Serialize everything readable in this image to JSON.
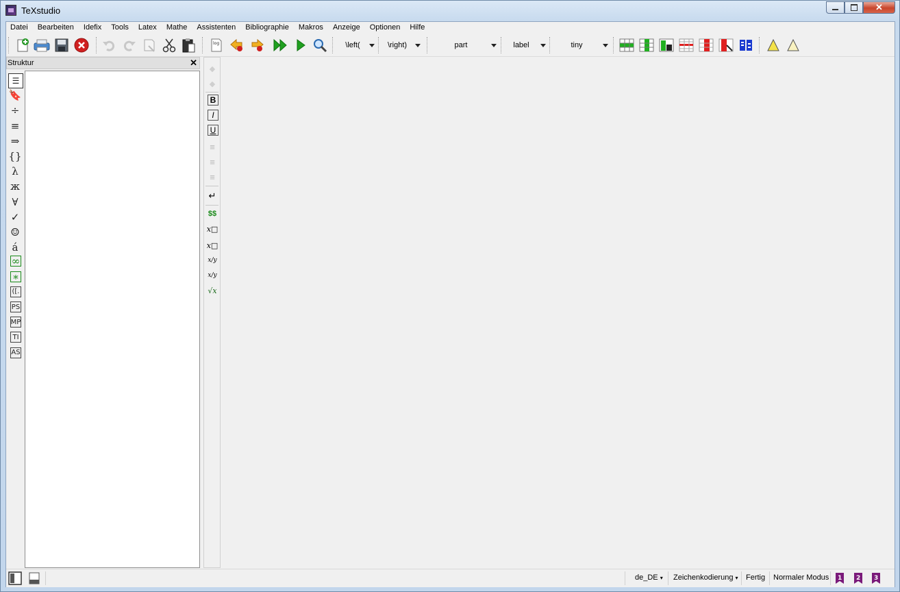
{
  "window": {
    "title": "TeXstudio"
  },
  "menu": [
    "Datei",
    "Bearbeiten",
    "Idefix",
    "Tools",
    "Latex",
    "Mathe",
    "Assistenten",
    "Bibliographie",
    "Makros",
    "Anzeige",
    "Optionen",
    "Hilfe"
  ],
  "toolbar": {
    "icons": [
      "new-document-icon",
      "print-icon",
      "save-icon",
      "close-document-icon",
      "undo-icon",
      "redo-icon",
      "copy-icon",
      "cut-icon",
      "paste-icon",
      "log-icon",
      "previous-error-icon",
      "next-error-icon",
      "build-and-view-icon",
      "compile-icon",
      "view-icon"
    ],
    "left_delim": "\\left(",
    "right_delim": "\\right)",
    "section": "part",
    "reference": "label",
    "size": "tiny",
    "table_icons": [
      "table-add-row-icon",
      "table-add-column-icon",
      "table-insert-column-icon",
      "table-remove-row-icon",
      "table-remove-column-icon",
      "table-cut-column-icon",
      "table-align-columns-icon",
      "warning-triangle-icon",
      "warning-triangle-outline-icon"
    ]
  },
  "structure": {
    "title": "Struktur",
    "close": "✕",
    "side_tabs": [
      {
        "name": "structure-icon",
        "glyph": "☰"
      },
      {
        "name": "bookmarks-icon",
        "glyph": "🔖"
      },
      {
        "name": "operators-icon",
        "glyph": "÷"
      },
      {
        "name": "relations-icon",
        "glyph": "≡"
      },
      {
        "name": "arrows-icon",
        "glyph": "⇒"
      },
      {
        "name": "delimiters-icon",
        "glyph": "{}"
      },
      {
        "name": "greek-icon",
        "glyph": "λ"
      },
      {
        "name": "cyrillic-icon",
        "glyph": "ж"
      },
      {
        "name": "misc-math-icon",
        "glyph": "∀"
      },
      {
        "name": "misc-items-icon",
        "glyph": "✓"
      },
      {
        "name": "wasysym-icon",
        "glyph": "☺"
      },
      {
        "name": "special-characters-icon",
        "glyph": "á"
      },
      {
        "name": "favorites-icon",
        "glyph": "∞"
      },
      {
        "name": "most-used-icon",
        "glyph": "∗"
      },
      {
        "name": "brackets-icon",
        "glyph": "([."
      },
      {
        "name": "pstricks-icon",
        "glyph": "PS"
      },
      {
        "name": "metapost-icon",
        "glyph": "MP"
      },
      {
        "name": "tikz-icon",
        "glyph": "TI"
      },
      {
        "name": "asymptote-icon",
        "glyph": "AS"
      }
    ]
  },
  "vertical_toolbar": [
    {
      "name": "back-icon",
      "glyph": "◆"
    },
    {
      "name": "forward-icon",
      "glyph": "◆"
    },
    {
      "name": "bold-icon",
      "glyph": "B"
    },
    {
      "name": "italic-icon",
      "glyph": "I"
    },
    {
      "name": "underline-icon",
      "glyph": "U"
    },
    {
      "name": "align-left-icon",
      "glyph": "≡"
    },
    {
      "name": "align-center-icon",
      "glyph": "≡"
    },
    {
      "name": "align-right-icon",
      "glyph": "≡"
    },
    {
      "name": "new-line-icon",
      "glyph": "↵"
    },
    {
      "name": "inline-math-icon",
      "glyph": "$$"
    },
    {
      "name": "subscript-icon",
      "glyph": "x□"
    },
    {
      "name": "superscript-icon",
      "glyph": "x□"
    },
    {
      "name": "fraction-icon",
      "glyph": "x/y"
    },
    {
      "name": "dfrac-icon",
      "glyph": "x/y"
    },
    {
      "name": "sqrt-icon",
      "glyph": "√x"
    }
  ],
  "status": {
    "language": "de_DE",
    "encoding": "Zeichenkodierung",
    "state": "Fertig",
    "mode": "Normaler Modus",
    "bookmarks": [
      "1",
      "2",
      "3"
    ]
  },
  "colors": {
    "titlebar": "#c7daee",
    "client": "#f0f0f0",
    "bookmark": "#7a1a7a",
    "close_button": "#c8452c"
  }
}
